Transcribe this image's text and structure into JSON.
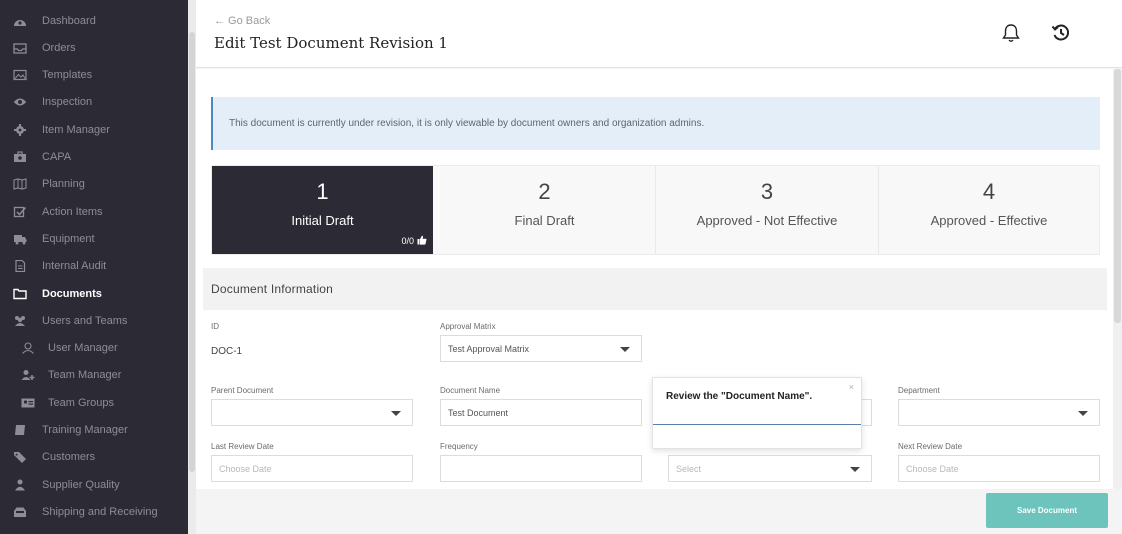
{
  "sidebar": {
    "items": [
      {
        "label": "Dashboard",
        "icon": "dashboard-icon"
      },
      {
        "label": "Orders",
        "icon": "inbox-icon"
      },
      {
        "label": "Templates",
        "icon": "image-icon"
      },
      {
        "label": "Inspection",
        "icon": "eye-icon"
      },
      {
        "label": "Item Manager",
        "icon": "gear-icon"
      },
      {
        "label": "CAPA",
        "icon": "briefcase-icon"
      },
      {
        "label": "Planning",
        "icon": "map-icon"
      },
      {
        "label": "Action Items",
        "icon": "checkbox-icon"
      },
      {
        "label": "Equipment",
        "icon": "truck-icon"
      },
      {
        "label": "Internal Audit",
        "icon": "file-icon"
      },
      {
        "label": "Documents",
        "icon": "folder-icon",
        "active": true
      },
      {
        "label": "Users and Teams",
        "icon": "users-icon"
      },
      {
        "label": "User Manager",
        "icon": "user-icon",
        "sub": true
      },
      {
        "label": "Team Manager",
        "icon": "user-plus-icon",
        "sub": true
      },
      {
        "label": "Team Groups",
        "icon": "id-card-icon",
        "sub": true
      },
      {
        "label": "Training Manager",
        "icon": "book-icon"
      },
      {
        "label": "Customers",
        "icon": "tag-icon"
      },
      {
        "label": "Supplier Quality",
        "icon": "person-icon"
      },
      {
        "label": "Shipping and Receiving",
        "icon": "tray-icon"
      }
    ]
  },
  "header": {
    "go_back": "← Go Back",
    "title": "Edit Test Document Revision 1",
    "icons": [
      "bell-icon",
      "history-icon"
    ]
  },
  "banner": {
    "text": "This document is currently under revision, it is only viewable by document owners and organization admins."
  },
  "steps": [
    {
      "number": "1",
      "label": "Initial Draft",
      "active": true,
      "count": "0/0"
    },
    {
      "number": "2",
      "label": "Final Draft"
    },
    {
      "number": "3",
      "label": "Approved - Not Effective"
    },
    {
      "number": "4",
      "label": "Approved - Effective"
    }
  ],
  "section": {
    "title": "Document Information"
  },
  "form": {
    "id_label": "ID",
    "id_value": "DOC-1",
    "approval_matrix_label": "Approval Matrix",
    "approval_matrix_value": "Test Approval Matrix",
    "parent_document_label": "Parent Document",
    "parent_document_value": "",
    "document_name_label": "Document Name",
    "document_name_value": "Test Document",
    "department_label": "Department",
    "department_value": "",
    "last_review_date_label": "Last Review Date",
    "last_review_date_placeholder": "Choose Date",
    "frequency_label": "Frequency",
    "frequency_value": "",
    "select_placeholder": "Select",
    "next_review_date_label": "Next Review Date",
    "next_review_date_placeholder": "Choose Date"
  },
  "tooltip": {
    "text": "Review the \"Document Name\".",
    "close": "×"
  },
  "save_button": {
    "label": "Save Document"
  },
  "colors": {
    "sidebar_bg": "#2c2b35",
    "active_step_bg": "#2c2b35",
    "banner_bg": "#e4eef8",
    "banner_border": "#4c89c4",
    "save_button_bg": "#6cc4bd"
  }
}
